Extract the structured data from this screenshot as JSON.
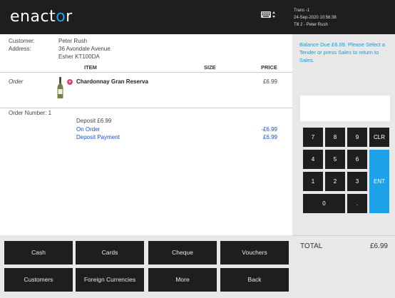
{
  "header": {
    "logo_prefix": "enact",
    "logo_dot": "o",
    "logo_suffix": "r",
    "trans": "Trans -1",
    "datetime": "24-Sep-2020 10:56:38",
    "till": "Till 2 - Peter Rush"
  },
  "customer": {
    "customer_label": "Customer:",
    "customer_name": "Peter Rush",
    "address_label": "Address:",
    "address_line1": "36 Avondale Avenue",
    "address_line2": "Esher KT100DA"
  },
  "columns": {
    "item": "ITEM",
    "size": "SIZE",
    "price": "PRICE"
  },
  "order": {
    "label": "Order",
    "item_name": "Chardonnay Gran Reserva",
    "item_price": "£6.99"
  },
  "deposit": {
    "order_number": "Order Number: 1",
    "deposit_title": "Deposit £6.99",
    "on_order_label": "On Order",
    "on_order_amount": "-£6.99",
    "deposit_payment_label": "Deposit Payment",
    "deposit_payment_amount": "£6.99"
  },
  "message": "Balance Due £6.99. Please Select a Tender or press Sales to return to Sales.",
  "keypad": {
    "k7": "7",
    "k8": "8",
    "k9": "9",
    "clr": "CLR",
    "k4": "4",
    "k5": "5",
    "k6": "6",
    "k1": "1",
    "k2": "2",
    "k3": "3",
    "ent": "ENT",
    "k0": "0",
    "dot": "."
  },
  "total": {
    "label": "TOTAL",
    "value": "£6.99"
  },
  "actions": {
    "cash": "Cash",
    "cards": "Cards",
    "cheque": "Cheque",
    "vouchers": "Vouchers",
    "customers": "Customers",
    "foreign": "Foreign Currencies",
    "more": "More",
    "back": "Back"
  },
  "colors": {
    "accent": "#1da1e8",
    "header_bg": "#1e1e1e",
    "message": "#1a9ad6",
    "deposit_blue": "#1a4fcf"
  }
}
